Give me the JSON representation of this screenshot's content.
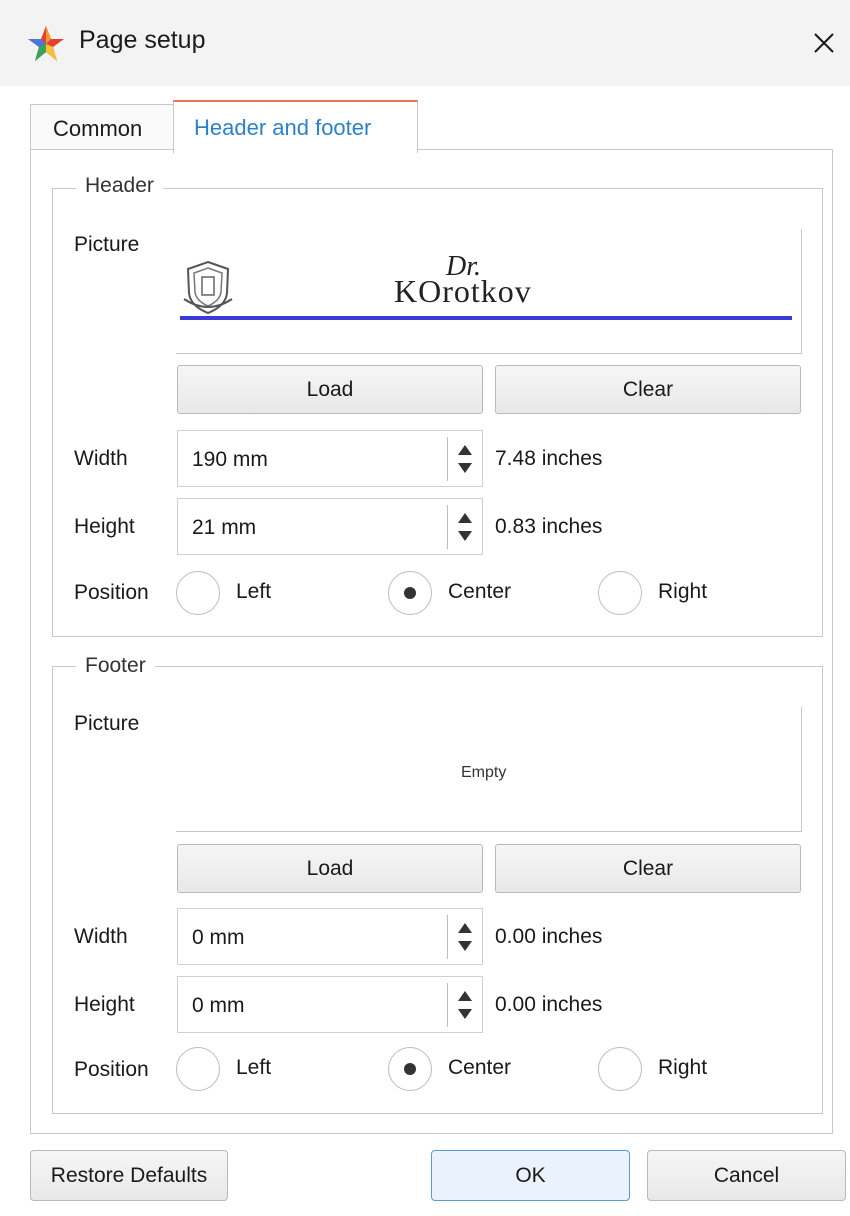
{
  "window": {
    "title": "Page setup"
  },
  "tabs": [
    {
      "label": "Common"
    },
    {
      "label": "Header and footer"
    }
  ],
  "header": {
    "legend": "Header",
    "picture_label": "Picture",
    "picture": {
      "logo_script": "Dr.",
      "logo_text": "KOrotkov"
    },
    "load_label": "Load",
    "clear_label": "Clear",
    "width": {
      "label": "Width",
      "value": "190 mm",
      "inches": "7.48 inches"
    },
    "height": {
      "label": "Height",
      "value": "21 mm",
      "inches": "0.83 inches"
    },
    "position": {
      "label": "Position",
      "options": [
        "Left",
        "Center",
        "Right"
      ],
      "selected": "Center"
    }
  },
  "footer": {
    "legend": "Footer",
    "picture_label": "Picture",
    "picture": {
      "empty_text": "Empty"
    },
    "load_label": "Load",
    "clear_label": "Clear",
    "width": {
      "label": "Width",
      "value": "0 mm",
      "inches": "0.00 inches"
    },
    "height": {
      "label": "Height",
      "value": "0 mm",
      "inches": "0.00 inches"
    },
    "position": {
      "label": "Position",
      "options": [
        "Left",
        "Center",
        "Right"
      ],
      "selected": "Center"
    }
  },
  "buttons": {
    "restore_defaults": "Restore Defaults",
    "ok": "OK",
    "cancel": "Cancel"
  },
  "colors": {
    "accent": "#2c82c9",
    "tab_highlight": "#e8745b",
    "header_rule": "#3b3bd6",
    "ok_border": "#5b9bd5"
  },
  "icons": {
    "app": "colored-star-icon",
    "close": "close-icon",
    "spin_up": "triangle-up-icon",
    "spin_down": "triangle-down-icon",
    "seal": "shield-emblem-icon"
  }
}
